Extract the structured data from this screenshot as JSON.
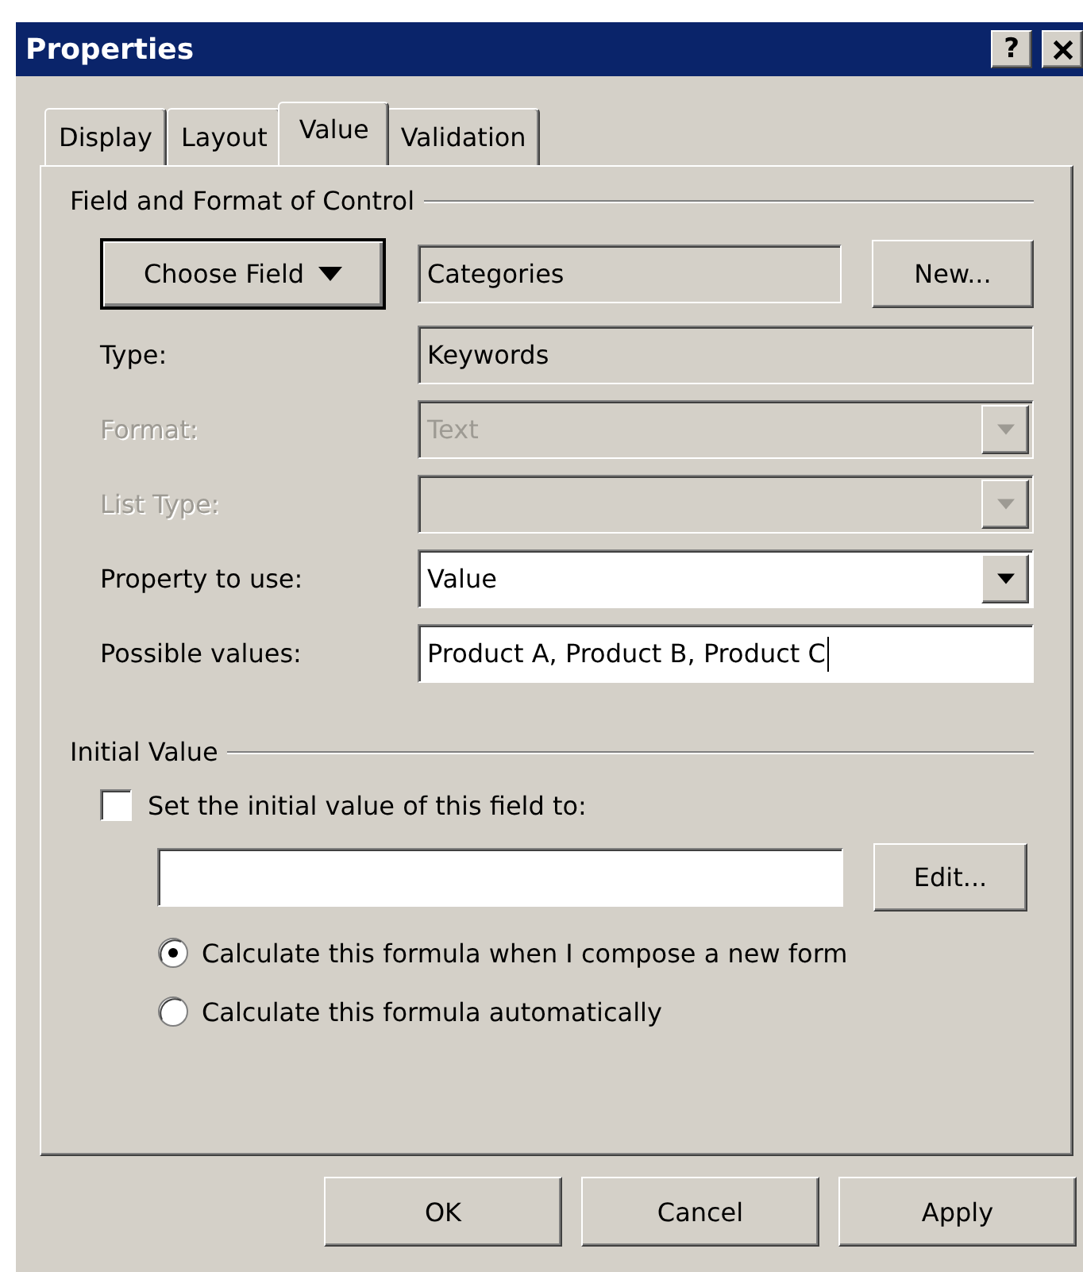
{
  "window": {
    "title": "Properties",
    "help_button": "?"
  },
  "tabs": [
    {
      "label": "Display",
      "selected": false
    },
    {
      "label": "Layout",
      "selected": false
    },
    {
      "label": "Value",
      "selected": true
    },
    {
      "label": "Validation",
      "selected": false
    }
  ],
  "field_group": {
    "legend": "Field and Format of Control",
    "choose_button": "Choose Field",
    "field_name": "Categories",
    "new_button": "New...",
    "rows": [
      {
        "label": "Type:",
        "kind": "readonly",
        "value": "Keywords",
        "disabled": false
      },
      {
        "label": "Format:",
        "kind": "dropdown",
        "value": "Text",
        "disabled": true
      },
      {
        "label": "List Type:",
        "kind": "dropdown",
        "disabled": true
      },
      {
        "label": "Property to use:",
        "kind": "dropdown",
        "value": "Value",
        "disabled": false
      },
      {
        "label": "Possible values:",
        "kind": "input",
        "value": "Product A, Product B, Product C",
        "disabled": false
      }
    ]
  },
  "initial_group": {
    "legend": "Initial Value",
    "checkbox": {
      "label": "Set the initial value of this field to:",
      "checked": false
    },
    "edit_button": "Edit...",
    "radios": [
      {
        "label": "Calculate this formula when I compose a new form",
        "selected": true
      },
      {
        "label": "Calculate this formula automatically",
        "selected": false
      }
    ]
  },
  "buttons": [
    "OK",
    "Cancel",
    "Apply"
  ]
}
